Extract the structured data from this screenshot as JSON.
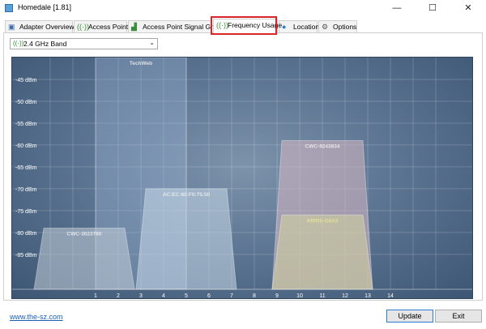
{
  "window": {
    "title": "Homedale [1.81]",
    "minimize": "—",
    "maximize": "☐",
    "close": "✕"
  },
  "tabs": [
    {
      "label": "Adapter Overview",
      "icon": "network-adapter-icon"
    },
    {
      "label": "Access Points",
      "icon": "wifi-signal-icon"
    },
    {
      "label": "Access Point Signal Graph",
      "icon": "signal-graph-icon"
    },
    {
      "label": "Frequency Usage",
      "icon": "wifi-signal-icon"
    },
    {
      "label": "Location",
      "icon": "map-pin-icon"
    },
    {
      "label": "Options",
      "icon": "settings-icon"
    }
  ],
  "active_tab": "Frequency Usage",
  "band_select": {
    "value": "2.4 GHz Band"
  },
  "colors": {
    "highlight": "#d8262b",
    "chart_bg": "#5d7693",
    "link": "#1a5fb4"
  },
  "chart_data": {
    "type": "area",
    "x_ticks": [
      "1",
      "2",
      "3",
      "4",
      "5",
      "6",
      "7",
      "8",
      "9",
      "10",
      "11",
      "12",
      "13",
      "14"
    ],
    "y_ticks": [
      "-45 dBm",
      "-50 dBm",
      "-55 dBm",
      "-60 dBm",
      "-65 dBm",
      "-70 dBm",
      "-75 dBm",
      "-80 dBm",
      "-85 dBm"
    ],
    "ylim": [
      -93,
      -40
    ],
    "grid": true,
    "networks": [
      {
        "name": "TechWeb",
        "channel_start": 1,
        "channel_end": 5,
        "dbm": -40,
        "color": "#9db6d6"
      },
      {
        "name": "CWC-3023780",
        "channel_start": -1.5,
        "channel_end": 2.5,
        "dbm": -79,
        "color": "#c5cdd8"
      },
      {
        "name": "AC:EC:80:F0:75:50",
        "channel_start": 3,
        "channel_end": 7,
        "dbm": -70,
        "color": "#c8d8ea"
      },
      {
        "name": "CWC-9243834",
        "channel_start": 9,
        "channel_end": 13,
        "dbm": -59,
        "color": "#d9b8c4"
      },
      {
        "name": "ARRIS-D6A2",
        "channel_start": 9,
        "channel_end": 13,
        "dbm": -76,
        "color": "#d6d6a0"
      }
    ]
  },
  "footer": {
    "link": "www.the-sz.com",
    "update": "Update",
    "exit": "Exit"
  }
}
